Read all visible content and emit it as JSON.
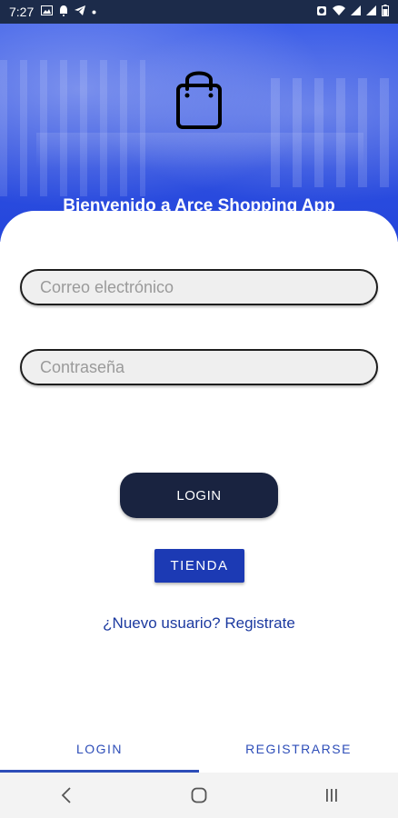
{
  "status_bar": {
    "time": "7:27",
    "icons_left": [
      "image-icon",
      "notification-icon",
      "telegram-icon",
      "dot-icon"
    ],
    "icons_right": [
      "alarm-icon",
      "wifi-icon",
      "signal-icon",
      "signal-icon",
      "battery-icon"
    ]
  },
  "hero": {
    "icon": "shopping-bag-icon",
    "welcome_text": "Bienvenido a Arce Shopping App"
  },
  "form": {
    "email_placeholder": "Correo electrónico",
    "password_placeholder": "Contraseña",
    "login_label": "LOGIN",
    "store_label": "TIENDA",
    "register_link": "¿Nuevo usuario? Registrate"
  },
  "tabs": [
    {
      "label": "LOGIN",
      "selected": true
    },
    {
      "label": "REGISTRARSE",
      "selected": false
    }
  ],
  "nav": [
    "back-icon",
    "home-icon",
    "recents-icon"
  ],
  "colors": {
    "status_bar": "#1c2b4a",
    "hero": "#2f50e0",
    "login_button": "#192340",
    "store_button": "#1c3ab4",
    "link": "#1c3aa0",
    "tab": "#2d4db8"
  }
}
